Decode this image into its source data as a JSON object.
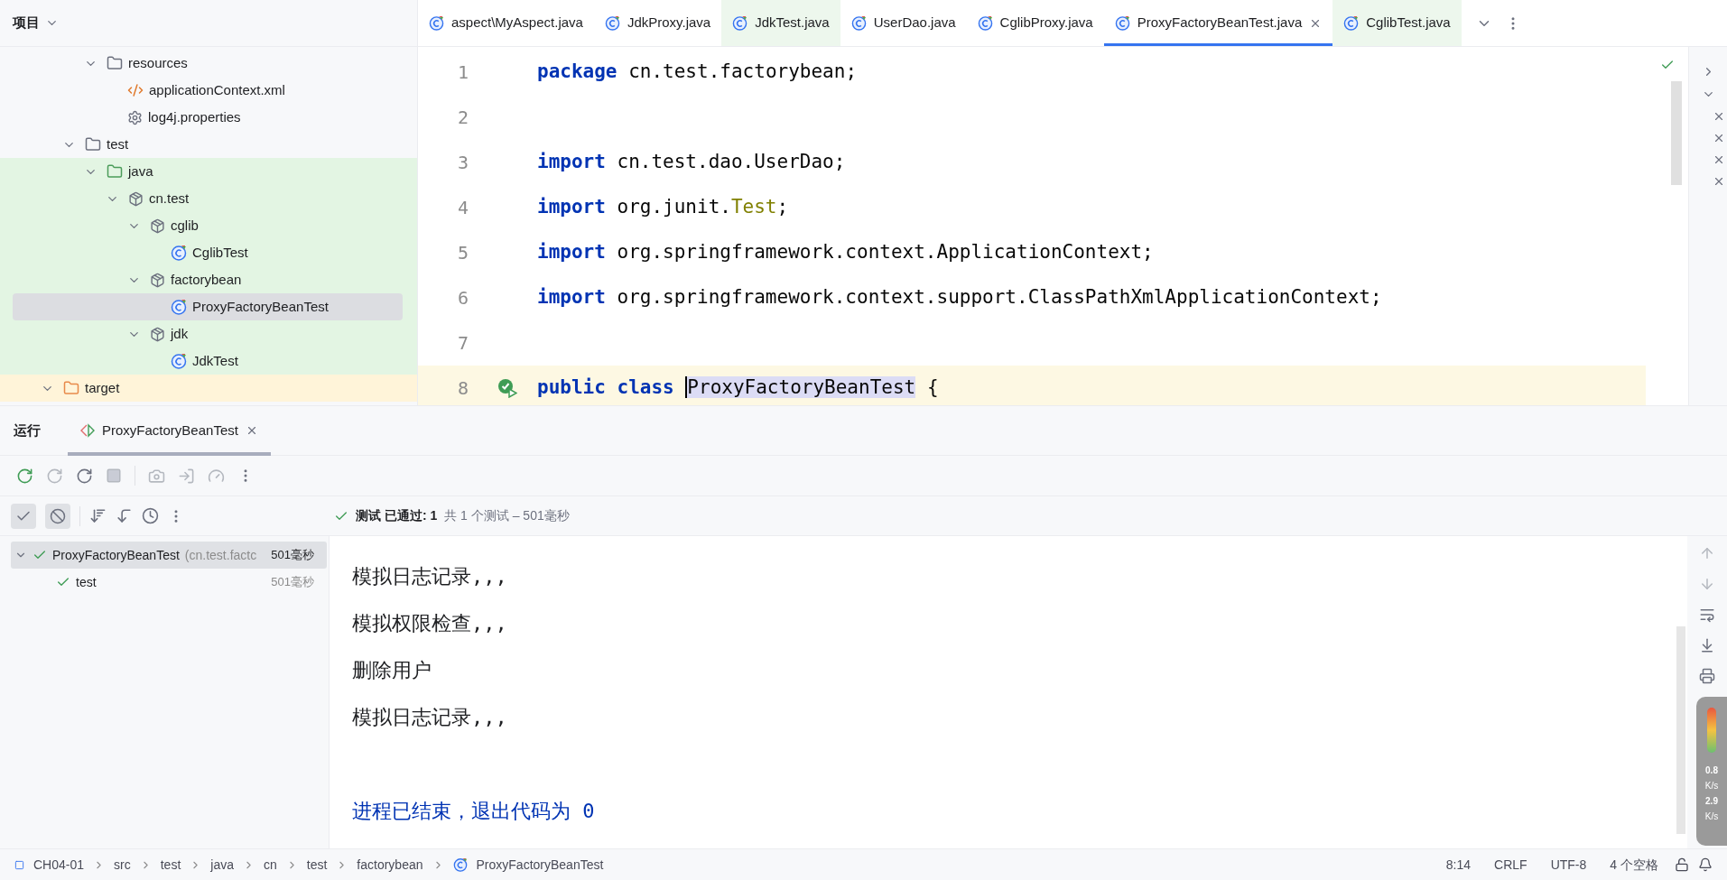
{
  "project_panel": {
    "title": "项目",
    "tree": [
      {
        "children": [
          {
            "children": [
              {
                "label": "resources",
                "kind": "resources",
                "expanded": true,
                "selected": false,
                "test_source": false,
                "children": [
                  {
                    "label": "applicationContext.xml",
                    "kind": "xml",
                    "selected": false,
                    "test_source": false
                  },
                  {
                    "label": "log4j.properties",
                    "kind": "properties",
                    "selected": false,
                    "test_source": false
                  }
                ]
              }
            ]
          },
          {
            "label": "test",
            "kind": "folder",
            "expanded": true,
            "selected": false,
            "test_source": false,
            "children": [
              {
                "label": "java",
                "kind": "testroot",
                "expanded": true,
                "selected": false,
                "test_source": true,
                "children": [
                  {
                    "label": "cn.test",
                    "kind": "package",
                    "expanded": true,
                    "selected": false,
                    "test_source": true,
                    "children": [
                      {
                        "label": "cglib",
                        "kind": "package",
                        "expanded": true,
                        "selected": false,
                        "test_source": true,
                        "children": [
                          {
                            "label": "CglibTest",
                            "kind": "testclass",
                            "selected": false,
                            "test_source": true
                          }
                        ]
                      },
                      {
                        "label": "factorybean",
                        "kind": "package",
                        "expanded": true,
                        "selected": false,
                        "test_source": true,
                        "children": [
                          {
                            "label": "ProxyFactoryBeanTest",
                            "kind": "testclass",
                            "selected": true,
                            "test_source": true
                          }
                        ]
                      },
                      {
                        "label": "jdk",
                        "kind": "package",
                        "expanded": true,
                        "selected": false,
                        "test_source": true,
                        "children": [
                          {
                            "label": "JdkTest",
                            "kind": "testclass",
                            "selected": false,
                            "test_source": true
                          }
                        ]
                      }
                    ]
                  }
                ]
              }
            ]
          }
        ]
      },
      {
        "label": "target",
        "kind": "excluded",
        "expanded": true,
        "selected": false
      }
    ]
  },
  "editor_tabs": [
    {
      "label": "aspect\\MyAspect.java",
      "selected": false,
      "test": false
    },
    {
      "label": "JdkProxy.java",
      "selected": false,
      "test": false
    },
    {
      "label": "JdkTest.java",
      "selected": false,
      "test": true
    },
    {
      "label": "UserDao.java",
      "selected": false,
      "test": false
    },
    {
      "label": "CglibProxy.java",
      "selected": false,
      "test": false
    },
    {
      "label": "ProxyFactoryBeanTest.java",
      "selected": true,
      "test": false
    },
    {
      "label": "CglibTest.java",
      "selected": false,
      "test": true
    }
  ],
  "editor": {
    "lines": [
      {
        "number": "1",
        "current": false,
        "run_marker": false,
        "tokens": [
          {
            "text": "package",
            "kind": "keyword"
          },
          {
            "text": " cn.test.factorybean;",
            "kind": "plain"
          }
        ]
      },
      {
        "number": "2",
        "current": false,
        "run_marker": false
      },
      {
        "number": "3",
        "current": false,
        "run_marker": false,
        "tokens": [
          {
            "text": "import",
            "kind": "keyword"
          },
          {
            "text": " cn.test.dao.UserDao;",
            "kind": "plain"
          }
        ]
      },
      {
        "number": "4",
        "current": false,
        "run_marker": false,
        "tokens": [
          {
            "text": "import",
            "kind": "keyword"
          },
          {
            "text": " org.junit.",
            "kind": "plain"
          },
          {
            "text": "Test",
            "kind": "annotation"
          },
          {
            "text": ";",
            "kind": "plain"
          }
        ]
      },
      {
        "number": "5",
        "current": false,
        "run_marker": false,
        "tokens": [
          {
            "text": "import",
            "kind": "keyword"
          },
          {
            "text": " org.springframework.context.ApplicationContext;",
            "kind": "plain"
          }
        ]
      },
      {
        "number": "6",
        "current": false,
        "run_marker": false,
        "tokens": [
          {
            "text": "import",
            "kind": "keyword"
          },
          {
            "text": " org.springframework.context.support.ClassPathXmlApplicationContext;",
            "kind": "plain"
          }
        ]
      },
      {
        "number": "7",
        "current": false,
        "run_marker": false
      },
      {
        "number": "8",
        "current": true,
        "run_marker": true,
        "tokens": [
          {
            "text": "public class",
            "kind": "keyword"
          },
          {
            "text": "ProxyFactoryBeanTest",
            "kind": "selected"
          },
          {
            "text": " {",
            "kind": "plain"
          }
        ]
      }
    ]
  },
  "run_panel": {
    "title": "运行",
    "tab": {
      "label": "ProxyFactoryBeanTest",
      "selected": true
    },
    "toolbar_toggles": [
      {
        "kind": "passed",
        "on": true
      },
      {
        "kind": "ignored",
        "on": true
      }
    ],
    "status_passed": "测试 已通过: 1",
    "status_summary": "共 1 个测试 – 501毫秒",
    "results": [
      {
        "name": "ProxyFactoryBeanTest",
        "detail": "(cn.test.factc",
        "time": "501毫秒",
        "passed": true,
        "selected": true,
        "children": [
          {
            "name": "test",
            "time": "501毫秒",
            "passed": true,
            "selected": false
          }
        ]
      }
    ],
    "console": [
      {
        "text": "模拟日志记录,,,",
        "kind": "output"
      },
      {
        "text": "模拟权限检查,,,",
        "kind": "output"
      },
      {
        "text": "删除用户",
        "kind": "output"
      },
      {
        "text": "模拟日志记录,,,",
        "kind": "output"
      },
      {
        "kind": "blank"
      },
      {
        "text": "进程已结束，退出代码为 0",
        "kind": "system"
      }
    ]
  },
  "overlay_widget": {
    "up": "0.8",
    "up_unit": "K/s",
    "down": "2.9",
    "down_unit": "K/s"
  },
  "status_bar": {
    "breadcrumbs": [
      "CH04-01",
      "src",
      "test",
      "java",
      "cn",
      "test",
      "factorybean",
      "ProxyFactoryBeanTest"
    ],
    "items": [
      "8:14",
      "CRLF",
      "UTF-8",
      "4 个空格"
    ]
  }
}
